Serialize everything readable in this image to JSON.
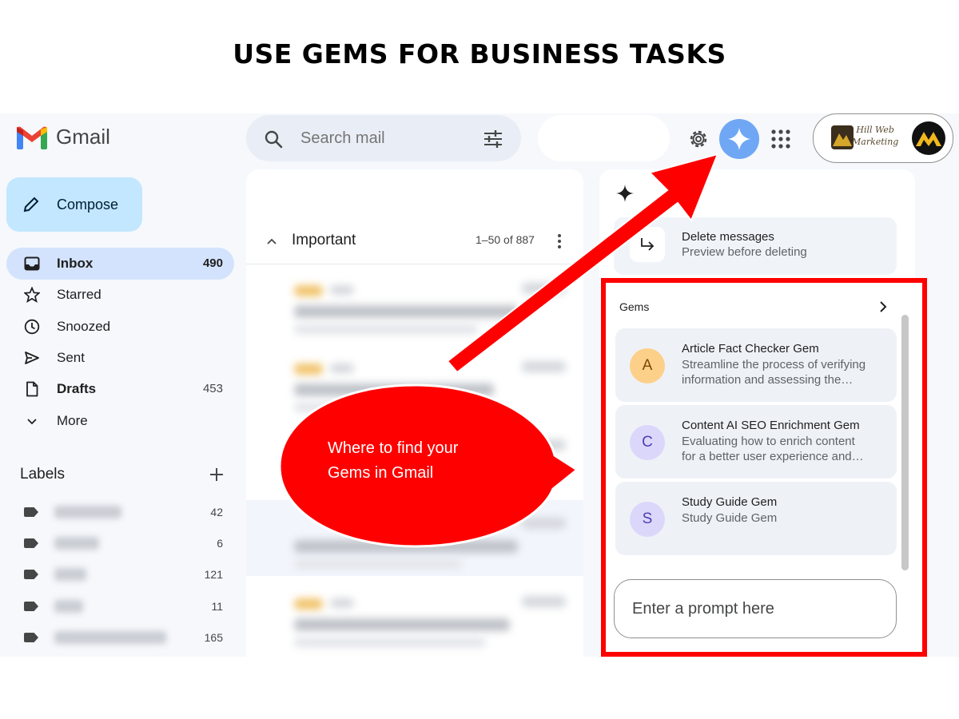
{
  "headline": "USE GEMS FOR BUSINESS TASKS",
  "app": {
    "name": "Gmail"
  },
  "search": {
    "placeholder": "Search mail"
  },
  "brand": {
    "line1": "Hill Web",
    "line2": "Marketing"
  },
  "sidebar": {
    "compose_label": "Compose",
    "items": [
      {
        "label": "Inbox",
        "count": "490",
        "icon": "inbox-icon"
      },
      {
        "label": "Starred",
        "count": "",
        "icon": "star-icon"
      },
      {
        "label": "Snoozed",
        "count": "",
        "icon": "clock-icon"
      },
      {
        "label": "Sent",
        "count": "",
        "icon": "send-icon"
      },
      {
        "label": "Drafts",
        "count": "453",
        "icon": "draft-icon"
      },
      {
        "label": "More",
        "count": "",
        "icon": "chevron-down-icon"
      }
    ],
    "labels_heading": "Labels",
    "labels": [
      {
        "count": "42"
      },
      {
        "count": "6"
      },
      {
        "count": "121"
      },
      {
        "count": "11"
      },
      {
        "count": "165"
      }
    ]
  },
  "main": {
    "section_label": "Important",
    "range": "1–50 of 887"
  },
  "side_panel": {
    "suggestion": {
      "title": "Delete messages",
      "subtitle": "Preview before deleting"
    },
    "gems_heading": "Gems",
    "gems": [
      {
        "initial": "A",
        "title": "Article Fact Checker Gem",
        "desc_line1": "Streamline the process of verifying",
        "desc_line2": "information and assessing the…",
        "color": "#fdd08a",
        "text_color": "#7a4a00"
      },
      {
        "initial": "C",
        "title": "Content AI SEO Enrichment Gem",
        "desc_line1": "Evaluating how to enrich content",
        "desc_line2": "for a better user experience and…",
        "color": "#dbd7fb",
        "text_color": "#4c3fb5"
      },
      {
        "initial": "S",
        "title": "Study Guide Gem",
        "desc_line1": "Study Guide Gem",
        "desc_line2": "",
        "color": "#dbd7fb",
        "text_color": "#4c3fb5"
      }
    ],
    "prompt_placeholder": "Enter a prompt here"
  },
  "callout": {
    "line1": "Where to find your",
    "line2": "Gems in Gmail"
  },
  "colors": {
    "annotation_red": "#ff0000",
    "compose_bg": "#c2e7ff",
    "active_nav": "#d3e3fd",
    "gem_button": "#6fa7f5"
  }
}
